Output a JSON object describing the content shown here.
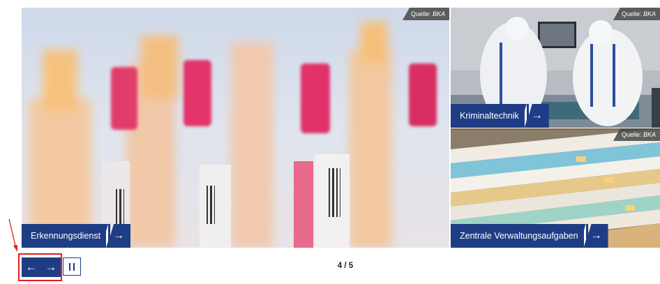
{
  "tiles": {
    "main": {
      "caption": "Erkennungsdienst",
      "source_label": "Quelle:",
      "source": "BKA"
    },
    "krim": {
      "caption": "Kriminaltechnik",
      "source_label": "Quelle:",
      "source": "BKA"
    },
    "zent": {
      "caption": "Zentrale Verwaltungsaufgaben",
      "source_label": "Quelle:",
      "source": "BKA"
    }
  },
  "controls": {
    "prev_glyph": "←",
    "next_glyph": "→",
    "caption_arrow": "→"
  },
  "pagination": {
    "current": "4",
    "separator": "/",
    "total": "5",
    "text": "4 / 5"
  },
  "colors": {
    "brand": "#1e3d84",
    "highlight": "#e02020"
  }
}
